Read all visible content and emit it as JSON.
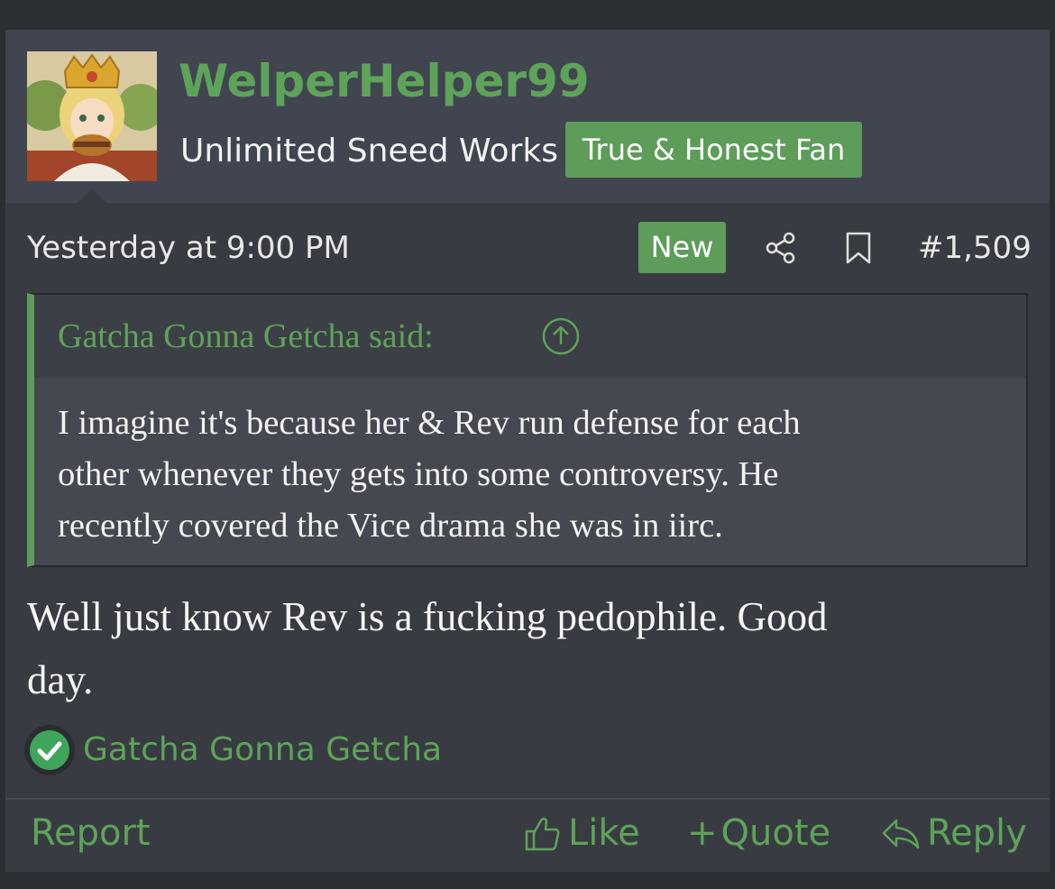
{
  "colors": {
    "accent": "#5d9c59",
    "link_text": "#5ea35a",
    "page_bg": "#2b2e33",
    "post_bg": "#383b41",
    "header_bg": "#414550"
  },
  "user": {
    "name": "WelperHelper99",
    "title": "Unlimited Sneed Works",
    "banner": "True & Honest Fan",
    "avatar_icon": "avatar-image"
  },
  "meta": {
    "date": "Yesterday at 9:00 PM",
    "new_badge": "New",
    "share_icon": "share-icon",
    "bookmark_icon": "bookmark-icon",
    "post_number": "#1,509"
  },
  "quote": {
    "author": "Gatcha Gonna Getcha said:",
    "jump_icon": "arrow-up-circle-icon",
    "lines": [
      "I imagine it's because her & Rev run defense for each",
      "other whenever they gets into some controversy. He",
      "recently covered the Vice drama she was in iirc."
    ]
  },
  "message": {
    "lines": [
      "Well just know Rev is a fucking pedophile. Good",
      "day."
    ]
  },
  "reactions": {
    "icon": "checkmark-icon",
    "user": "Gatcha Gonna Getcha"
  },
  "actions": {
    "report": "Report",
    "like": "Like",
    "quote_prefix": "+",
    "quote": "Quote",
    "reply": "Reply"
  }
}
